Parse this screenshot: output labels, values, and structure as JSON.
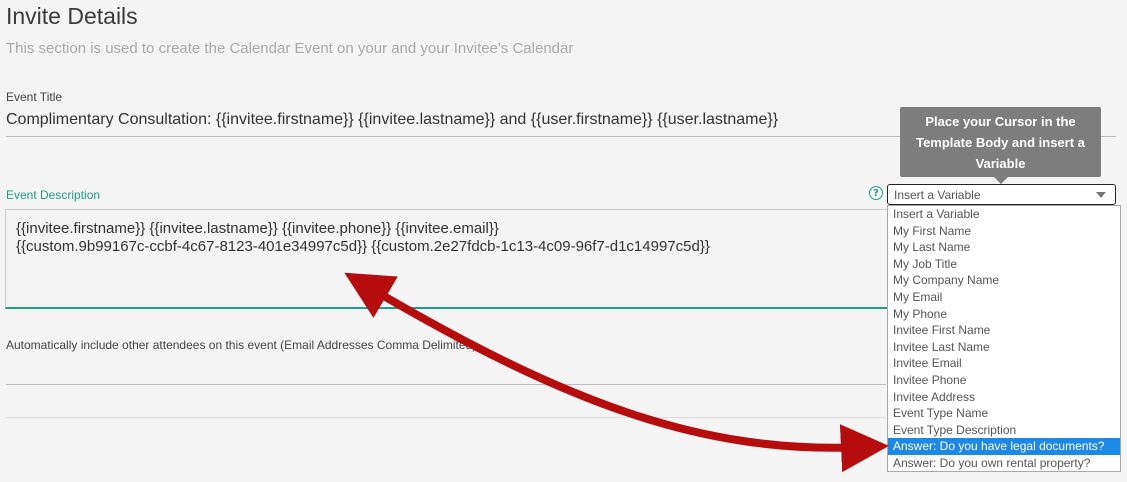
{
  "header": {
    "title": "Invite Details",
    "subtitle": "This section is used to create the Calendar Event on your and your Invitee's Calendar"
  },
  "event_title": {
    "label": "Event Title",
    "value": "Complimentary Consultation: {{invitee.firstname}} {{invitee.lastname}} and {{user.firstname}} {{user.lastname}}"
  },
  "event_description": {
    "label": "Event Description",
    "line1": "{{invitee.firstname}} {{invitee.lastname}} {{invitee.phone}} {{invitee.email}}",
    "line2": "{{custom.9b99167c-ccbf-4c67-8123-401e34997c5d}} {{custom.2e27fdcb-1c13-4c09-96f7-d1c14997c5d}}"
  },
  "attendees": {
    "label": "Automatically include other attendees on this event (Email Addresses Comma Delimited)"
  },
  "help_icon_glyph": "?",
  "tooltip": {
    "text": "Place your Cursor in the Template Body and insert a Variable"
  },
  "variable_select": {
    "selected": "Insert a Variable",
    "options": [
      "Insert a Variable",
      "My First Name",
      "My Last Name",
      "My Job Title",
      "My Company Name",
      "My Email",
      "My Phone",
      "Invitee First Name",
      "Invitee Last Name",
      "Invitee Email",
      "Invitee Phone",
      "Invitee Address",
      "Event Type Name",
      "Event Type Description",
      "Answer: Do you have legal documents?",
      "Answer: Do you own rental property?"
    ],
    "highlighted_index": 14
  },
  "colors": {
    "accent": "#1f9e86",
    "highlight": "#1e88e5",
    "arrow": "#b50d0d",
    "tooltip_bg": "#7d7d7d"
  }
}
